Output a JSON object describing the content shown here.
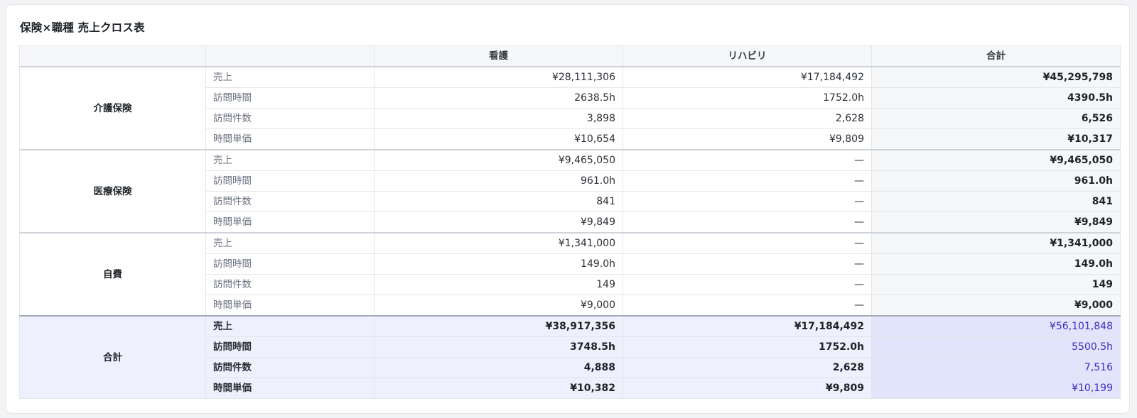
{
  "title": "保険×職種 売上クロス表",
  "columns": {
    "group": "",
    "metric": "",
    "nursing": "看護",
    "rehab": "リハビリ",
    "total": "合計"
  },
  "groups": [
    {
      "name": "介護保険",
      "rows": [
        {
          "metric": "売上",
          "nursing": "¥28,111,306",
          "rehab": "¥17,184,492",
          "total": "¥45,295,798"
        },
        {
          "metric": "訪問時間",
          "nursing": "2638.5h",
          "rehab": "1752.0h",
          "total": "4390.5h"
        },
        {
          "metric": "訪問件数",
          "nursing": "3,898",
          "rehab": "2,628",
          "total": "6,526"
        },
        {
          "metric": "時間単価",
          "nursing": "¥10,654",
          "rehab": "¥9,809",
          "total": "¥10,317"
        }
      ]
    },
    {
      "name": "医療保険",
      "rows": [
        {
          "metric": "売上",
          "nursing": "¥9,465,050",
          "rehab": "—",
          "total": "¥9,465,050"
        },
        {
          "metric": "訪問時間",
          "nursing": "961.0h",
          "rehab": "—",
          "total": "961.0h"
        },
        {
          "metric": "訪問件数",
          "nursing": "841",
          "rehab": "—",
          "total": "841"
        },
        {
          "metric": "時間単価",
          "nursing": "¥9,849",
          "rehab": "—",
          "total": "¥9,849"
        }
      ]
    },
    {
      "name": "自費",
      "rows": [
        {
          "metric": "売上",
          "nursing": "¥1,341,000",
          "rehab": "—",
          "total": "¥1,341,000"
        },
        {
          "metric": "訪問時間",
          "nursing": "149.0h",
          "rehab": "—",
          "total": "149.0h"
        },
        {
          "metric": "訪問件数",
          "nursing": "149",
          "rehab": "—",
          "total": "149"
        },
        {
          "metric": "時間単価",
          "nursing": "¥9,000",
          "rehab": "—",
          "total": "¥9,000"
        }
      ]
    },
    {
      "name": "合計",
      "rows": [
        {
          "metric": "売上",
          "nursing": "¥38,917,356",
          "rehab": "¥17,184,492",
          "total": "¥56,101,848"
        },
        {
          "metric": "訪問時間",
          "nursing": "3748.5h",
          "rehab": "1752.0h",
          "total": "5500.5h"
        },
        {
          "metric": "訪問件数",
          "nursing": "4,888",
          "rehab": "2,628",
          "total": "7,516"
        },
        {
          "metric": "時間単価",
          "nursing": "¥10,382",
          "rehab": "¥9,809",
          "total": "¥10,199"
        }
      ]
    }
  ],
  "colors": {
    "grand_row_bg": "#eef0fd",
    "grand_total_bg": "#e1e4fb",
    "grand_total_text": "#3b2fc0"
  }
}
